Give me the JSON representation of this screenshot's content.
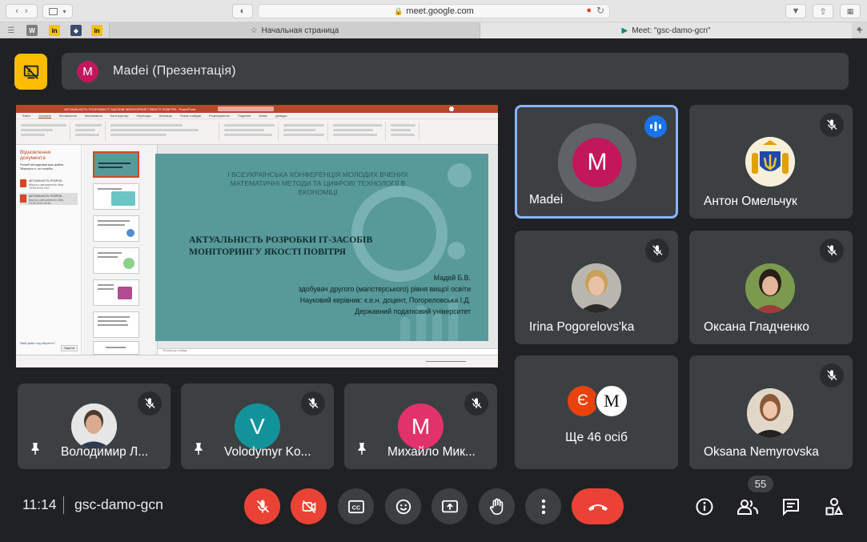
{
  "browser": {
    "url": "meet.google.com",
    "tabs": [
      {
        "label": "Начальная страница"
      },
      {
        "label": "Meet: \"gsc-damo-gcn\""
      }
    ]
  },
  "presentation": {
    "presenter_initial": "M",
    "banner_title": "Madei (Презентація)",
    "ppt": {
      "title_bar": "АКТУАЛЬНІСТЬ РОЗРОБКИ ІТ-ЗАСОБІВ МОНІТОРИНГУ ЯКОСТІ ПОВІТРЯ - PowerPoint",
      "menu": [
        "Файл",
        "Основне",
        "Вставлення",
        "Малювання",
        "Конструктор",
        "Переходи",
        "Анімація",
        "Показ слайдів",
        "Рецензування",
        "Подання",
        "Запис",
        "Довідка"
      ],
      "recovery_heading": "Відновлення документа",
      "recovery_text": "PowerPoint відновив ваш файли. Збережіть ті, які потрібні.",
      "recovery_files": [
        {
          "name": "АКТУАЛЬНІСТЬ РОЗРОБ...",
          "sub": "Версія з автоматично збер.",
          "date": "15.05.2024 9:40"
        },
        {
          "name": "АКТУАЛЬНІСТЬ РОЗРОБ...",
          "sub": "Версія з автоматично збер.",
          "date": "15.05.2024 10:56"
        }
      ],
      "recovery_link": "Який файл слід зберегти?",
      "recovery_close": "Закрити",
      "notes_placeholder": "Нотатки до слайда",
      "slide_conf": "І ВСЕУКРАЇНСЬКА КОНФЕРЕНЦІЯ МОЛОДИХ ВЧЕНИХ МАТЕМАТИЧНІ МЕТОДИ ТА ЦИФРОВІ ТЕХНОЛОГІЇ В ЕКОНОМІЦІ",
      "slide_title": "АКТУАЛЬНІСТЬ РОЗРОБКИ ІТ-ЗАСОБІВ МОНІТОРИНГУ ЯКОСТІ ПОВІТРЯ",
      "slide_author": "Мадей Б.В.",
      "slide_degree": "здобувач другого (магістерського) рівня вищої освіти",
      "slide_supervisor": "Науковий керівник: к.е.н. доцент, Погореловська І.Д.",
      "slide_university": "Державний податковий університет"
    }
  },
  "participants": [
    {
      "name": "Madei",
      "initial": "M",
      "color": "#c2185b",
      "speaking": true
    },
    {
      "name": "Антон Омельчук",
      "muted": true
    },
    {
      "name": "Irina Pogorelovs'ka",
      "muted": true
    },
    {
      "name": "Оксана Гладченко",
      "muted": true
    },
    {
      "name": "Oksana Nemyrovska",
      "muted": true
    }
  ],
  "pinned": [
    {
      "name": "Володимир Л..."
    },
    {
      "name": "Volodymyr Ko...",
      "initial": "V",
      "color": "#12939a"
    },
    {
      "name": "Михайло Мик...",
      "initial": "M",
      "color": "#e2326b"
    }
  ],
  "others": {
    "avatars": [
      "Є",
      "M"
    ],
    "label": "Ще 46 осіб"
  },
  "bottom_bar": {
    "time": "11:14",
    "meeting_code": "gsc-damo-gcn",
    "people_count": "55"
  },
  "colors": {
    "background": "#202124",
    "tile": "#3c4043",
    "danger": "#ea4335",
    "accent": "#8ab4f8",
    "present_icon": "#fbbc04"
  }
}
